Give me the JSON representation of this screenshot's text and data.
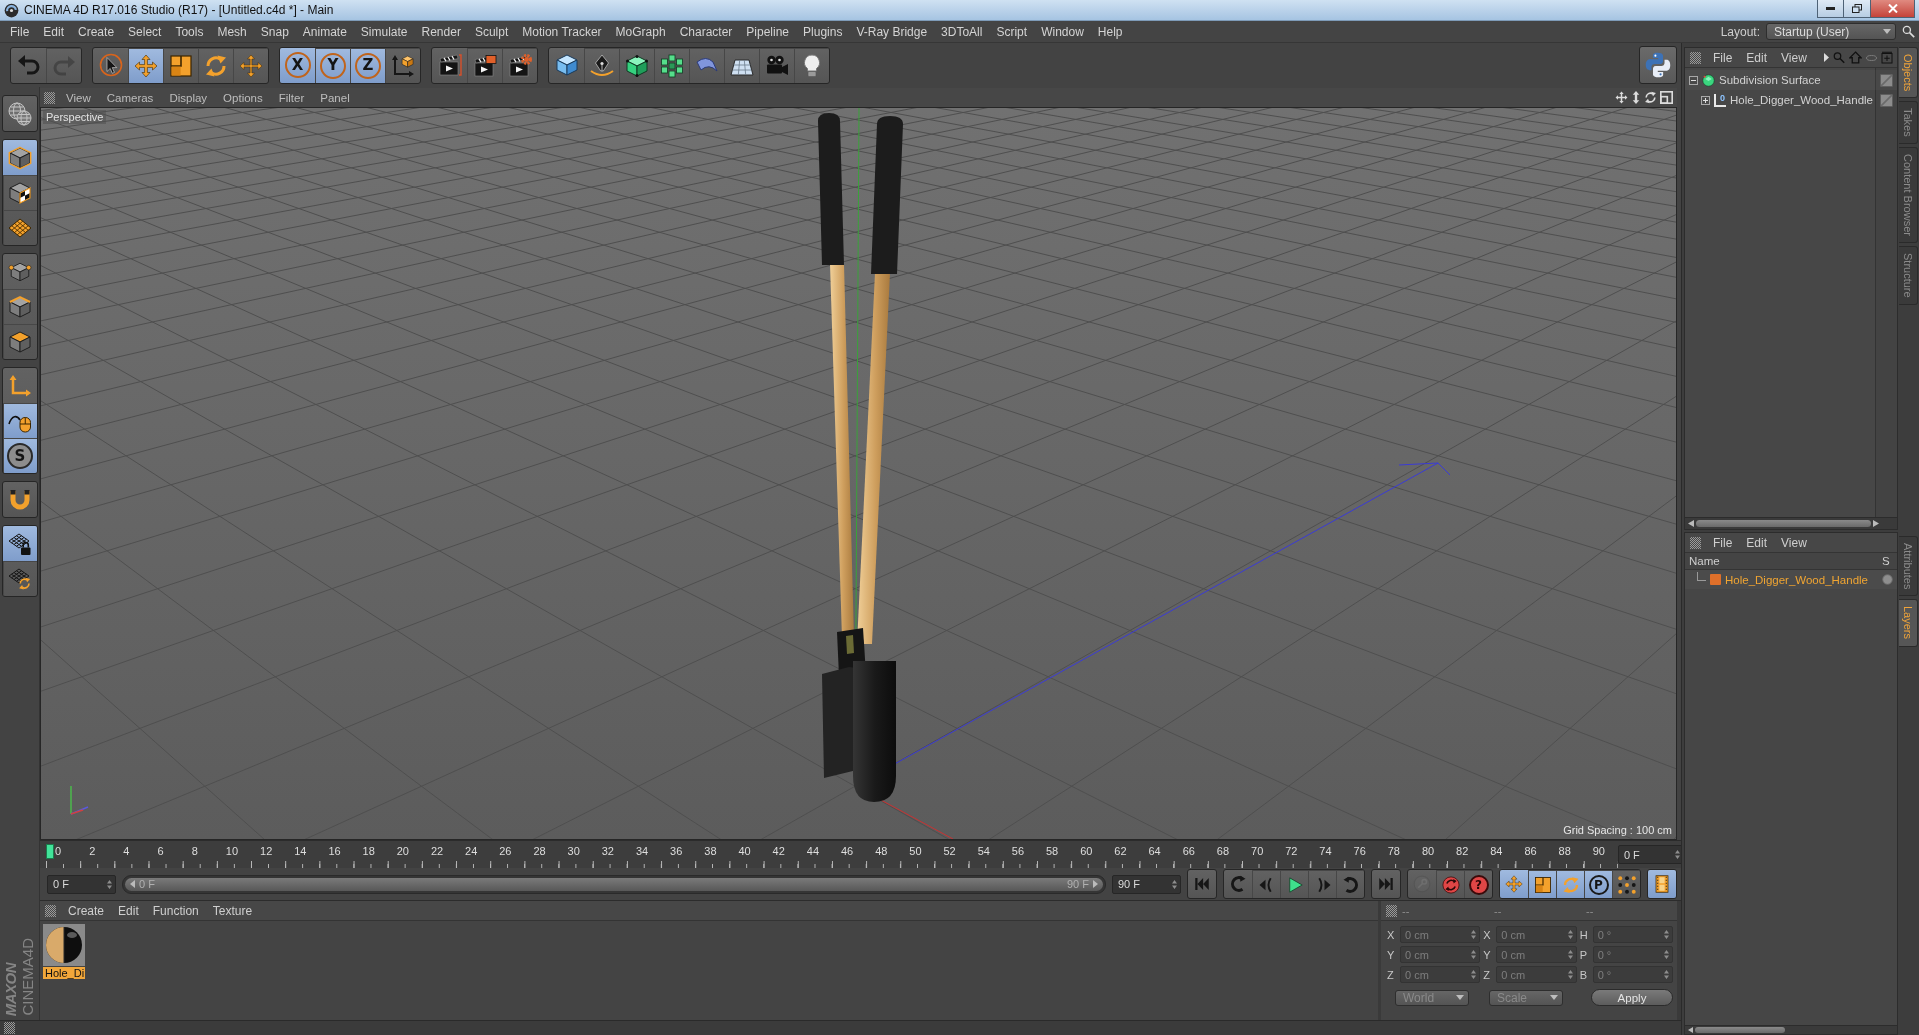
{
  "window": {
    "title": "CINEMA 4D R17.016 Studio (R17) - [Untitled.c4d *] - Main"
  },
  "menu_bar": {
    "items": [
      "File",
      "Edit",
      "Create",
      "Select",
      "Tools",
      "Mesh",
      "Snap",
      "Animate",
      "Simulate",
      "Render",
      "Sculpt",
      "Motion Tracker",
      "MoGraph",
      "Character",
      "Pipeline",
      "Plugins",
      "V-Ray Bridge",
      "3DToAll",
      "Script",
      "Window",
      "Help"
    ],
    "layout_label": "Layout:",
    "layout_value": "Startup (User)"
  },
  "toolbar": {
    "groups": [
      {
        "items": [
          {
            "kind": "undo",
            "active": false,
            "disabled": false
          },
          {
            "kind": "redo",
            "active": false,
            "disabled": true
          }
        ]
      },
      {
        "items": [
          {
            "kind": "select",
            "active": false,
            "disabled": false
          },
          {
            "kind": "move",
            "active": true,
            "disabled": false
          },
          {
            "kind": "scale",
            "active": false,
            "disabled": false
          },
          {
            "kind": "rotate",
            "active": false,
            "disabled": false
          },
          {
            "kind": "recent",
            "active": false,
            "disabled": false
          }
        ]
      },
      {
        "items": [
          {
            "kind": "axis",
            "label": "X",
            "active": true,
            "disabled": false
          },
          {
            "kind": "axis",
            "label": "Y",
            "active": true,
            "disabled": false
          },
          {
            "kind": "axis",
            "label": "Z",
            "active": true,
            "disabled": false
          },
          {
            "kind": "coords",
            "active": false,
            "disabled": false
          }
        ]
      },
      {
        "items": [
          {
            "kind": "renderview",
            "active": false,
            "disabled": false
          },
          {
            "kind": "renderpicture",
            "active": false,
            "disabled": false
          },
          {
            "kind": "rendersettings",
            "active": false,
            "disabled": false
          }
        ]
      },
      {
        "items": [
          {
            "kind": "cube",
            "active": false,
            "disabled": false
          },
          {
            "kind": "pen",
            "active": false,
            "disabled": false
          },
          {
            "kind": "subdivision",
            "active": false,
            "disabled": false
          },
          {
            "kind": "cloner",
            "active": false,
            "disabled": false
          },
          {
            "kind": "deformer",
            "active": false,
            "disabled": false
          },
          {
            "kind": "floor",
            "active": false,
            "disabled": false
          },
          {
            "kind": "camera",
            "active": false,
            "disabled": false
          },
          {
            "kind": "light",
            "active": false,
            "disabled": false
          }
        ]
      }
    ]
  },
  "left_toolbar": {
    "groups": [
      {
        "items": [
          {
            "kind": "editable",
            "active": false,
            "disabled": false
          }
        ]
      },
      {
        "items": [
          {
            "kind": "model",
            "active": true,
            "disabled": false
          },
          {
            "kind": "texture",
            "active": false,
            "disabled": false
          },
          {
            "kind": "workplane",
            "active": false,
            "disabled": false
          }
        ]
      },
      {
        "items": [
          {
            "kind": "points",
            "active": false,
            "disabled": false
          },
          {
            "kind": "edges",
            "active": false,
            "disabled": false
          },
          {
            "kind": "polygons",
            "active": false,
            "disabled": false
          }
        ]
      },
      {
        "items": [
          {
            "kind": "axismode",
            "active": false,
            "disabled": false
          },
          {
            "kind": "tweak",
            "active": true,
            "disabled": false
          },
          {
            "kind": "solo",
            "label": "S",
            "active": true,
            "disabled": false
          }
        ]
      },
      {
        "items": [
          {
            "kind": "snap",
            "active": false,
            "disabled": false
          }
        ]
      },
      {
        "items": [
          {
            "kind": "lock",
            "active": true,
            "disabled": false
          },
          {
            "kind": "align",
            "active": false,
            "disabled": false
          }
        ]
      }
    ]
  },
  "viewport": {
    "menu": [
      "View",
      "Cameras",
      "Display",
      "Options",
      "Filter",
      "Panel"
    ],
    "camera": "Perspective",
    "grid_spacing": "Grid Spacing : 100 cm"
  },
  "timeline": {
    "ticks": [
      "0",
      "2",
      "4",
      "6",
      "8",
      "10",
      "12",
      "14",
      "16",
      "18",
      "20",
      "22",
      "24",
      "26",
      "28",
      "30",
      "32",
      "34",
      "36",
      "38",
      "40",
      "42",
      "44",
      "46",
      "48",
      "50",
      "52",
      "54",
      "56",
      "58",
      "60",
      "62",
      "64",
      "66",
      "68",
      "70",
      "72",
      "74",
      "76",
      "78",
      "80",
      "82",
      "84",
      "86",
      "88",
      "90"
    ],
    "playhead": {
      "level": 0
    },
    "current_frame": "0 F"
  },
  "range": {
    "start": "0 F",
    "slider_start": "0 F",
    "slider_end": "90 F",
    "level": 1,
    "end": "90 F"
  },
  "playback": {
    "groups": [
      {
        "items": [
          {
            "kind": "first",
            "active": false,
            "disabled": false
          }
        ]
      },
      {
        "items": [
          {
            "kind": "prevkey",
            "active": false,
            "disabled": false
          },
          {
            "kind": "prevframe",
            "active": false,
            "disabled": false
          },
          {
            "kind": "play",
            "active": false,
            "disabled": false
          },
          {
            "kind": "nextframe",
            "active": false,
            "disabled": false
          },
          {
            "kind": "nextkey",
            "active": false,
            "disabled": false
          }
        ]
      },
      {
        "items": [
          {
            "kind": "last",
            "active": false,
            "disabled": false
          }
        ]
      },
      {
        "items": [
          {
            "kind": "record",
            "active": false,
            "disabled": true
          },
          {
            "kind": "autokey",
            "active": false,
            "disabled": false
          },
          {
            "kind": "keysel",
            "label": "?",
            "active": false,
            "disabled": false
          }
        ]
      },
      {
        "items": [
          {
            "kind": "movekey",
            "active": true,
            "disabled": false
          },
          {
            "kind": "scalekey",
            "active": true,
            "disabled": false
          },
          {
            "kind": "rotatekey",
            "active": true,
            "disabled": false
          },
          {
            "kind": "parameter",
            "label": "P",
            "active": true,
            "disabled": false
          },
          {
            "kind": "pla",
            "active": false,
            "disabled": false
          }
        ]
      },
      {
        "items": [
          {
            "kind": "timeline",
            "active": true,
            "disabled": false
          }
        ]
      }
    ]
  },
  "material_manager": {
    "menu": [
      "Create",
      "Edit",
      "Function",
      "Texture"
    ],
    "materials": [
      {
        "name": "Hole_Di",
        "selected": true
      }
    ]
  },
  "coordinates": {
    "headers": [
      "--",
      "--",
      "--"
    ],
    "disabled": true,
    "rows": [
      [
        {
          "axis": "X",
          "value": "0 cm"
        },
        {
          "axis": "X",
          "value": "0 cm"
        },
        {
          "axis": "H",
          "value": "0 °"
        }
      ],
      [
        {
          "axis": "Y",
          "value": "0 cm"
        },
        {
          "axis": "Y",
          "value": "0 cm"
        },
        {
          "axis": "P",
          "value": "0 °"
        }
      ],
      [
        {
          "axis": "Z",
          "value": "0 cm"
        },
        {
          "axis": "Z",
          "value": "0 cm"
        },
        {
          "axis": "B",
          "value": "0 °"
        }
      ]
    ],
    "mode": "World",
    "size_mode": "Scale",
    "apply": "Apply"
  },
  "object_manager": {
    "menu": [
      "File",
      "Edit",
      "View"
    ],
    "objects": [
      {
        "name": "Subdivision Surface",
        "kind": "subdivision",
        "expanded": true,
        "children": [
          {
            "name": "Hole_Digger_Wood_Handle",
            "kind": "null",
            "icon_label": "0",
            "expanded": false
          }
        ]
      }
    ]
  },
  "layer_manager": {
    "menu": [
      "File",
      "Edit",
      "View"
    ],
    "columns": [
      "Name",
      "S"
    ],
    "layers": [
      {
        "name": "Hole_Digger_Wood_Handle",
        "color": "#e0702a"
      }
    ]
  },
  "side_tabs": {
    "upper": [
      {
        "label": "Objects",
        "selected": true
      },
      {
        "label": "Takes",
        "selected": false
      },
      {
        "label": "Content Browser",
        "selected": false
      },
      {
        "label": "Structure",
        "selected": false
      }
    ],
    "lower": [
      {
        "label": "Attributes",
        "selected": false
      },
      {
        "label": "Layers",
        "selected": true
      }
    ]
  },
  "logo": {
    "brand": "MAXON",
    "product": "CINEMA4D"
  }
}
